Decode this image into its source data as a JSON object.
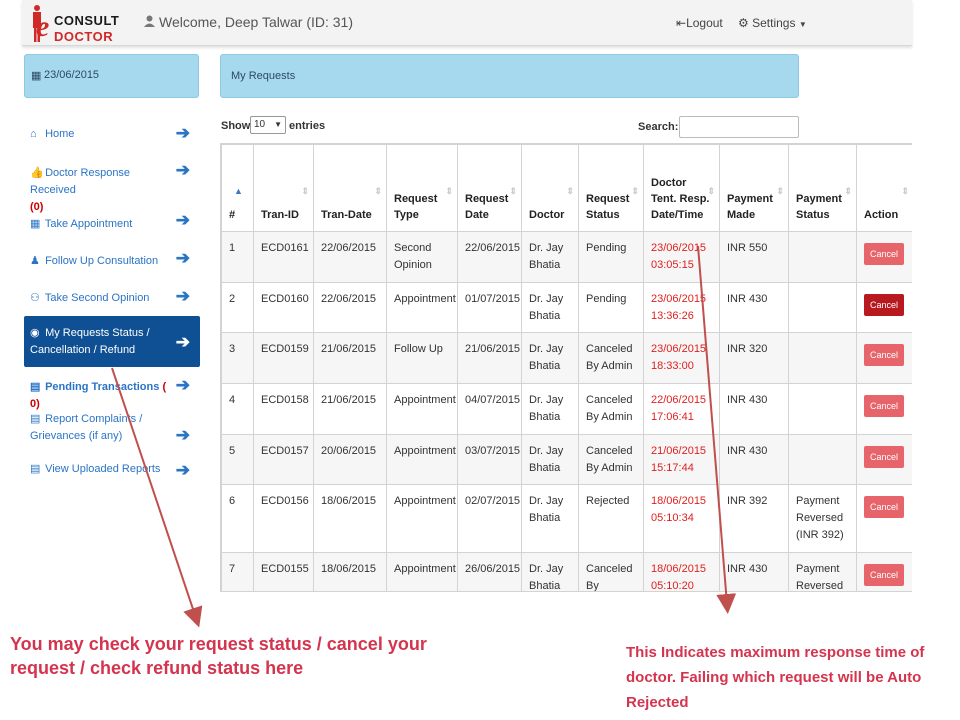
{
  "header": {
    "brand_line1": "CONSULT",
    "brand_line2": "DOCTOR",
    "brand_e": "e",
    "welcome": "Welcome, Deep Talwar (ID: 31)",
    "logout_label": "Logout",
    "settings_label": "Settings"
  },
  "sidebar": {
    "date": "23/06/2015",
    "items": [
      {
        "icon": "home-icon",
        "label": "Home",
        "count": ""
      },
      {
        "icon": "thumbs-up-icon",
        "label": "Doctor Response Received",
        "count": "(0)"
      },
      {
        "icon": "calendar-icon",
        "label": "Take Appointment",
        "count": ""
      },
      {
        "icon": "person-icon",
        "label": "Follow Up Consultation",
        "count": ""
      },
      {
        "icon": "users-icon",
        "label": "Take Second Opinion",
        "count": ""
      },
      {
        "icon": "eye-icon",
        "label": "My Requests Status / Cancellation / Refund",
        "count": ""
      },
      {
        "icon": "document-icon",
        "label": "Pending Transactions",
        "count": "( 0)"
      },
      {
        "icon": "document-icon",
        "label": "Report Complaints / Grievances (if any)",
        "count": ""
      },
      {
        "icon": "document-icon",
        "label": "View Uploaded Reports",
        "count": ""
      }
    ]
  },
  "main": {
    "title": "My Requests",
    "show_label": "Show",
    "entries_value": "10",
    "entries_label": "entries",
    "search_label": "Search:",
    "search_value": ""
  },
  "table": {
    "headers": [
      "#",
      "Tran-ID",
      "Tran-Date",
      "Request Type",
      "Request Date",
      "Doctor",
      "Request Status",
      "Doctor Tent. Resp. Date/Time",
      "Payment Made",
      "Payment Status",
      "Action"
    ],
    "rows": [
      {
        "no": "1",
        "tran_id": "ECD0161",
        "tran_date": "22/06/2015",
        "type": "Second Opinion",
        "req_date": "22/06/2015",
        "doctor": "Dr. Jay Bhatia",
        "status": "Pending",
        "resp": "23/06/2015 03:05:15",
        "payment": "INR 550",
        "pay_status": "",
        "action": "Cancel"
      },
      {
        "no": "2",
        "tran_id": "ECD0160",
        "tran_date": "22/06/2015",
        "type": "Appointment",
        "req_date": "01/07/2015",
        "doctor": "Dr. Jay Bhatia",
        "status": "Pending",
        "resp": "23/06/2015 13:36:26",
        "payment": "INR 430",
        "pay_status": "",
        "action": "Cancel"
      },
      {
        "no": "3",
        "tran_id": "ECD0159",
        "tran_date": "21/06/2015",
        "type": "Follow Up",
        "req_date": "21/06/2015",
        "doctor": "Dr. Jay Bhatia",
        "status": "Canceled By Admin",
        "resp": "23/06/2015 18:33:00",
        "payment": "INR 320",
        "pay_status": "",
        "action": "Cancel"
      },
      {
        "no": "4",
        "tran_id": "ECD0158",
        "tran_date": "21/06/2015",
        "type": "Appointment",
        "req_date": "04/07/2015",
        "doctor": "Dr. Jay Bhatia",
        "status": "Canceled By Admin",
        "resp": "22/06/2015 17:06:41",
        "payment": "INR 430",
        "pay_status": "",
        "action": "Cancel"
      },
      {
        "no": "5",
        "tran_id": "ECD0157",
        "tran_date": "20/06/2015",
        "type": "Appointment",
        "req_date": "03/07/2015",
        "doctor": "Dr. Jay Bhatia",
        "status": "Canceled By Admin",
        "resp": "21/06/2015 15:17:44",
        "payment": "INR 430",
        "pay_status": "",
        "action": "Cancel"
      },
      {
        "no": "6",
        "tran_id": "ECD0156",
        "tran_date": "18/06/2015",
        "type": "Appointment",
        "req_date": "02/07/2015",
        "doctor": "Dr. Jay Bhatia",
        "status": "Rejected",
        "resp": "18/06/2015 05:10:34",
        "payment": "INR 392",
        "pay_status": "Payment Reversed (INR 392)",
        "action": "Cancel"
      },
      {
        "no": "7",
        "tran_id": "ECD0155",
        "tran_date": "18/06/2015",
        "type": "Appointment",
        "req_date": "26/06/2015",
        "doctor": "Dr. Jay Bhatia",
        "status": "Canceled By Patient",
        "resp": "18/06/2015 05:10:20",
        "payment": "INR 430",
        "pay_status": "Payment Reversed",
        "action": "Cancel"
      }
    ]
  },
  "annotations": {
    "left": "You may check your request status / cancel your request / check refund  status here",
    "right": "This  Indicates maximum response time of doctor.  Failing which request will be Auto Rejected"
  },
  "colors": {
    "accent": "#a6d8ee",
    "active_nav": "#0f4f93",
    "link": "#2a74c6",
    "annotation": "#d4344e",
    "cancel_button": "#e7646a"
  }
}
